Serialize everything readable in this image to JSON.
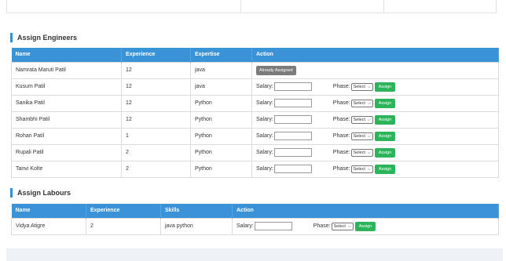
{
  "engineers": {
    "title": "Assign Engineers",
    "columns": [
      "Name",
      "Experience",
      "Expertise",
      "Action"
    ],
    "rows": [
      {
        "name": "Namrata Maruti Patil",
        "experience": "12",
        "expertise": "java",
        "status": "Already Assigned"
      },
      {
        "name": "Kusum Patil",
        "experience": "12",
        "expertise": "java"
      },
      {
        "name": "Sanika Patil",
        "experience": "12",
        "expertise": "Python"
      },
      {
        "name": "Shambhi Patil",
        "experience": "12",
        "expertise": "Python"
      },
      {
        "name": "Rohan Patil",
        "experience": "1",
        "expertise": "Python"
      },
      {
        "name": "Rupali Patil",
        "experience": "2",
        "expertise": "Python"
      },
      {
        "name": "Tanvi Kolte",
        "experience": "2",
        "expertise": "Python"
      }
    ]
  },
  "labours": {
    "title": "Assign Labours",
    "columns": [
      "Name",
      "Experience",
      "Skills",
      "Action"
    ],
    "rows": [
      {
        "name": "Vidya Atigre",
        "experience": "2",
        "skills": "java python"
      }
    ]
  },
  "action": {
    "salary_label": "Salary:",
    "phase_label": "Phase:",
    "select_value": "Select",
    "assign_label": "Assign"
  },
  "colors": {
    "header_blue": "#3a93d7",
    "assign_green": "#2bb45a",
    "assigned_grey": "#7b7b7b"
  }
}
